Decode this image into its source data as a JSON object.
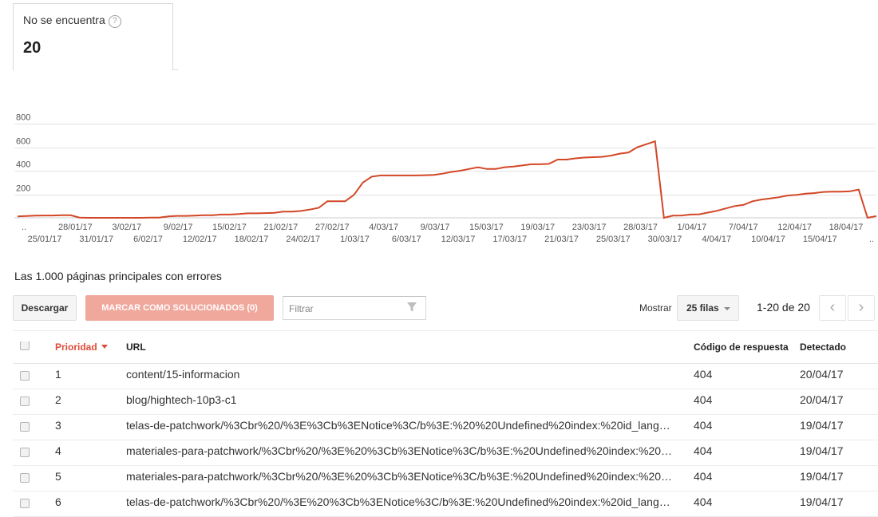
{
  "stat_card": {
    "label": "No se encuentra",
    "help_icon": "help-circle-icon",
    "value": "20"
  },
  "chart_data": {
    "type": "line",
    "y_ticks": [
      "200",
      "400",
      "600",
      "800"
    ],
    "ylim": [
      0,
      800
    ],
    "grid": true,
    "color": "#d24726",
    "x_labels_top": [
      "..",
      "28/01/17",
      "3/02/17",
      "9/02/17",
      "15/02/17",
      "21/02/17",
      "27/02/17",
      "4/03/17",
      "9/03/17",
      "15/03/17",
      "19/03/17",
      "23/03/17",
      "28/03/17",
      "1/04/17",
      "7/04/17",
      "12/04/17",
      "18/04/17"
    ],
    "x_labels_bottom": [
      "25/01/17",
      "31/01/17",
      "6/02/17",
      "12/02/17",
      "18/02/17",
      "24/02/17",
      "1/03/17",
      "6/03/17",
      "12/03/17",
      "17/03/17",
      "21/03/17",
      "25/03/17",
      "30/03/17",
      "4/04/17",
      "10/04/17",
      "15/04/17",
      ".."
    ],
    "values": [
      12,
      15,
      18,
      20,
      20,
      22,
      22,
      2,
      0,
      0,
      0,
      0,
      0,
      0,
      0,
      2,
      2,
      12,
      16,
      16,
      18,
      22,
      22,
      28,
      28,
      32,
      38,
      38,
      40,
      42,
      52,
      52,
      58,
      70,
      85,
      140,
      140,
      140,
      195,
      300,
      350,
      360,
      360,
      360,
      360,
      360,
      362,
      365,
      375,
      390,
      400,
      415,
      430,
      415,
      415,
      430,
      435,
      445,
      455,
      455,
      458,
      495,
      495,
      505,
      512,
      515,
      518,
      528,
      545,
      555,
      600,
      625,
      650,
      0,
      18,
      20,
      28,
      30,
      45,
      60,
      80,
      100,
      110,
      140,
      155,
      165,
      175,
      190,
      195,
      205,
      210,
      220,
      222,
      222,
      225,
      240,
      0,
      15
    ]
  },
  "table": {
    "section_title": "Las 1.000 páginas principales con errores",
    "download_label": "Descargar",
    "mark_label": "MARCAR COMO SOLUCIONADOS (0)",
    "filter_placeholder": "Filtrar",
    "filter_icon": "funnel-icon",
    "show_label": "Mostrar",
    "rows_option": "25 filas",
    "page_range": "1-20 de 20",
    "prev_icon": "chevron-left-icon",
    "next_icon": "chevron-right-icon",
    "headers": {
      "priority": "Prioridad",
      "url": "URL",
      "code": "Código de respuesta",
      "detected": "Detectado"
    },
    "rows": [
      {
        "priority": "1",
        "url": "content/15-informacion",
        "code": "404",
        "date": "20/04/17"
      },
      {
        "priority": "2",
        "url": "blog/hightech-10p3-c1",
        "code": "404",
        "date": "20/04/17"
      },
      {
        "priority": "3",
        "url": "telas-de-patchwork/%3Cbr%20/%3E%3Cb%3ENotice%3C/b%3E:%20%20Undefined%20index:%20id_lang…",
        "code": "404",
        "date": "19/04/17"
      },
      {
        "priority": "4",
        "url": "materiales-para-patchwork/%3Cbr%20/%3E%20%3Cb%3ENotice%3C/b%3E:%20Undefined%20index:%20…",
        "code": "404",
        "date": "19/04/17"
      },
      {
        "priority": "5",
        "url": "materiales-para-patchwork/%3Cbr%20/%3E%20%3Cb%3ENotice%3C/b%3E:%20Undefined%20index:%20…",
        "code": "404",
        "date": "19/04/17"
      },
      {
        "priority": "6",
        "url": "telas-de-patchwork/%3Cbr%20/%3E%20%3Cb%3ENotice%3C/b%3E:%20Undefined%20index:%20id_lang…",
        "code": "404",
        "date": "19/04/17"
      }
    ]
  }
}
